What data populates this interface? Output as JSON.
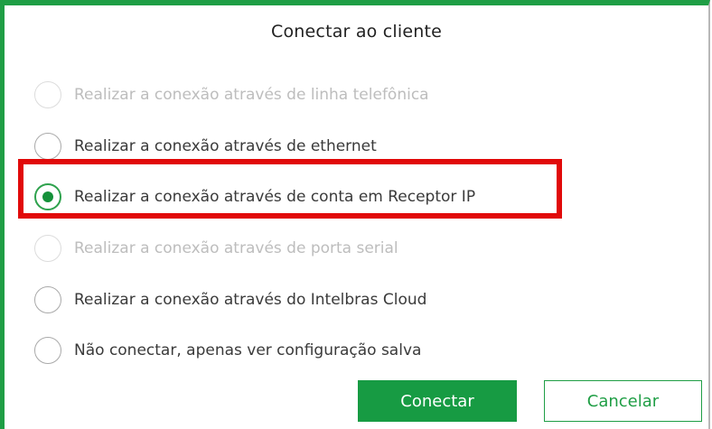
{
  "dialog": {
    "title": "Conectar ao cliente"
  },
  "options": [
    {
      "label": "Realizar a conexão através de linha telefônica",
      "selected": false,
      "disabled": true
    },
    {
      "label": "Realizar a conexão através de ethernet",
      "selected": false,
      "disabled": false
    },
    {
      "label": "Realizar a conexão através de conta em Receptor IP",
      "selected": true,
      "disabled": false
    },
    {
      "label": "Realizar a conexão através de porta serial",
      "selected": false,
      "disabled": true
    },
    {
      "label": "Realizar a conexão através do Intelbras Cloud",
      "selected": false,
      "disabled": false
    },
    {
      "label": "Não conectar, apenas ver configuração salva",
      "selected": false,
      "disabled": false
    }
  ],
  "buttons": {
    "connect": "Conectar",
    "cancel": "Cancelar"
  },
  "colors": {
    "accent": "#1f9e45",
    "highlight": "#e10a0a",
    "disabled_text": "#bdbdbd",
    "text": "#3a3a3a"
  }
}
